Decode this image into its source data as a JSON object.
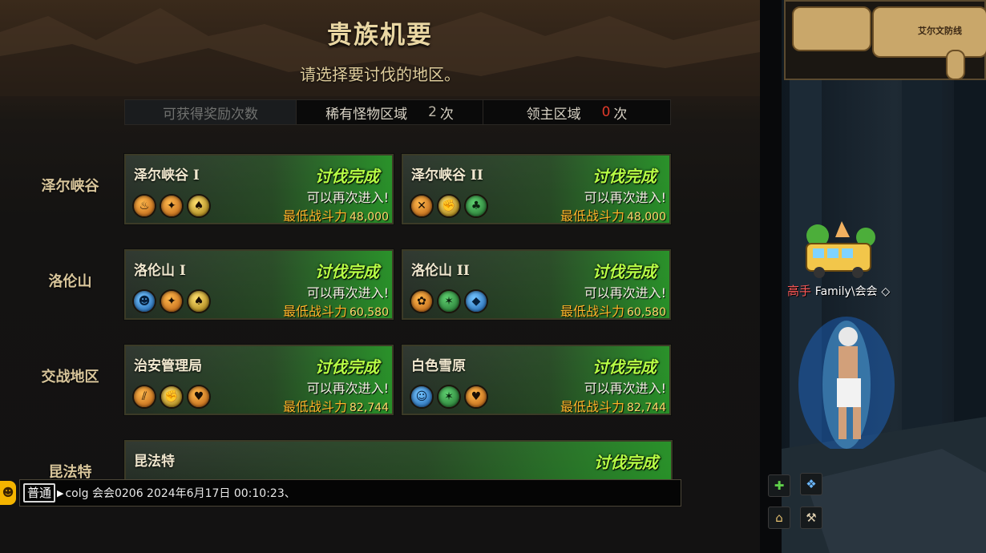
{
  "panel": {
    "title": "贵族机要",
    "subtitle": "请选择要讨伐的地区。",
    "reward_bar": {
      "label": "可获得奖励次数",
      "rare": {
        "label": "稀有怪物区域",
        "count": "2",
        "unit": "次"
      },
      "lord": {
        "label": "领主区域",
        "count": "0",
        "unit": "次"
      }
    },
    "regions": [
      "泽尔峡谷",
      "洛伦山",
      "交战地区",
      "昆法特"
    ],
    "cards": [
      {
        "name": "泽尔峡谷 I",
        "status": "讨伐完成",
        "note": "可以再次进入!",
        "power_label": "最低战斗力",
        "power": "48,000",
        "icons": [
          "torch-icon",
          "meat-icon",
          "spade-icon"
        ]
      },
      {
        "name": "泽尔峡谷 II",
        "status": "讨伐完成",
        "note": "可以再次进入!",
        "power_label": "最低战斗力",
        "power": "48,000",
        "icons": [
          "crossed-swords-icon",
          "fist-icon",
          "club-icon"
        ]
      },
      {
        "name": "洛伦山 I",
        "status": "讨伐完成",
        "note": "可以再次进入!",
        "power_label": "最低战斗力",
        "power": "60,580",
        "icons": [
          "mask-icon",
          "meat-icon",
          "spade-icon"
        ]
      },
      {
        "name": "洛伦山 II",
        "status": "讨伐完成",
        "note": "可以再次进入!",
        "power_label": "最低战斗力",
        "power": "60,580",
        "icons": [
          "leaf-icon",
          "star-icon",
          "diamond-icon"
        ]
      },
      {
        "name": "治安管理局",
        "status": "讨伐完成",
        "note": "可以再次进入!",
        "power_label": "最低战斗力",
        "power": "82,744",
        "icons": [
          "claw-icon",
          "fist-icon",
          "heart-icon"
        ]
      },
      {
        "name": "白色雪原",
        "status": "讨伐完成",
        "note": "可以再次进入!",
        "power_label": "最低战斗力",
        "power": "82,744",
        "icons": [
          "face-icon",
          "star-icon",
          "heart-icon"
        ]
      },
      {
        "name": "昆法特",
        "status": "讨伐完成"
      }
    ]
  },
  "chat": {
    "channel": "普通",
    "message": "colg 会会0206 2024年6月17日 00:10:23、"
  },
  "scene": {
    "minimap_label": "艾尔文防线",
    "guild_tag": "高手",
    "player_name": "Family\\会会"
  },
  "colors": {
    "accent_green": "#b7ff45",
    "power_orange": "#ffb52a",
    "lord_count_red": "#e03a2a"
  }
}
